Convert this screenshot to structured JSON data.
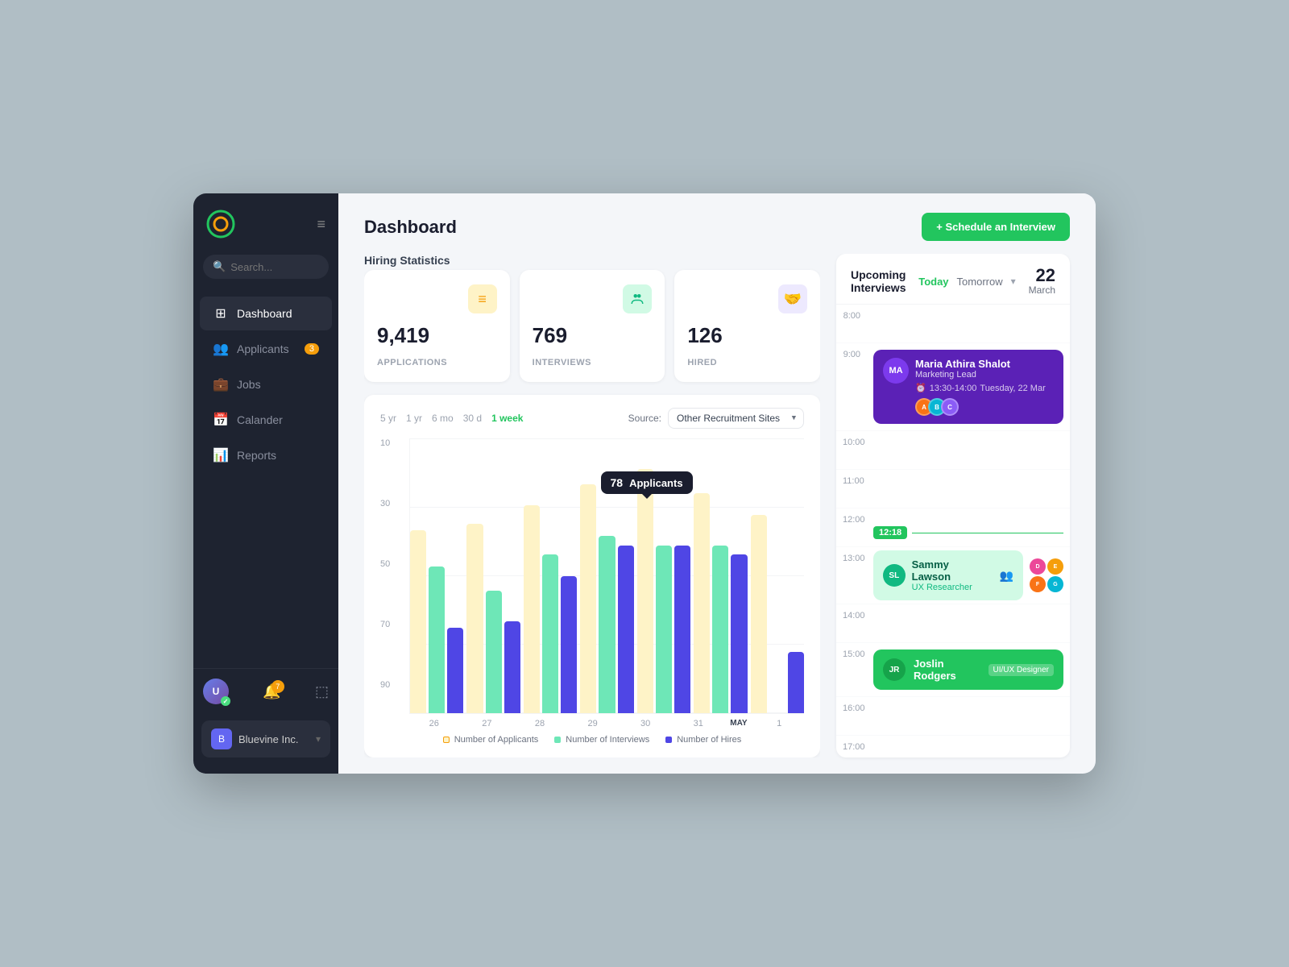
{
  "app": {
    "logo_text": "O",
    "company": "Bluevine Inc."
  },
  "sidebar": {
    "search_placeholder": "Search...",
    "nav_items": [
      {
        "id": "dashboard",
        "label": "Dashboard",
        "icon": "⊞",
        "active": true,
        "badge": null
      },
      {
        "id": "applicants",
        "label": "Applicants",
        "icon": "👥",
        "active": false,
        "badge": "3"
      },
      {
        "id": "jobs",
        "label": "Jobs",
        "icon": "💼",
        "active": false,
        "badge": null
      },
      {
        "id": "calendar",
        "label": "Calander",
        "icon": "📅",
        "active": false,
        "badge": null
      },
      {
        "id": "reports",
        "label": "Reports",
        "icon": "📊",
        "active": false,
        "badge": null
      }
    ],
    "user_notif_count": "7"
  },
  "header": {
    "title": "Dashboard",
    "schedule_btn": "+ Schedule an Interview"
  },
  "stats": {
    "section_title": "Hiring Statistics",
    "cards": [
      {
        "number": "9,419",
        "label": "APPLICATIONS",
        "icon": "≡",
        "icon_class": "stat-icon-yellow"
      },
      {
        "number": "769",
        "label": "INTERVIEWS",
        "icon": "👥",
        "icon_class": "stat-icon-green"
      },
      {
        "number": "126",
        "label": "HIRED",
        "icon": "🤝",
        "icon_class": "stat-icon-purple"
      }
    ]
  },
  "chart": {
    "time_filters": [
      "5 yr",
      "1 yr",
      "6 mo",
      "30 d",
      "1 week"
    ],
    "active_filter": "1 week",
    "source_label": "Source:",
    "source_value": "Other Recruitment Sites",
    "y_labels": [
      "90",
      "70",
      "50",
      "30",
      "10"
    ],
    "x_labels": [
      "26",
      "27",
      "28",
      "29",
      "30",
      "31",
      "1"
    ],
    "may_label": "MAY",
    "tooltip": {
      "number": "78",
      "label": "Applicants"
    },
    "bars": [
      {
        "applicants": 60,
        "interviews": 48,
        "hires": 28
      },
      {
        "applicants": 62,
        "interviews": 40,
        "hires": 30
      },
      {
        "applicants": 68,
        "interviews": 52,
        "hires": 45
      },
      {
        "applicants": 75,
        "interviews": 58,
        "hires": 55
      },
      {
        "applicants": 80,
        "interviews": 55,
        "hires": 55
      },
      {
        "applicants": 72,
        "interviews": 55,
        "hires": 52
      },
      {
        "applicants": 65,
        "interviews": 0,
        "hires": 20
      }
    ],
    "legend": [
      {
        "label": "Number of Applicants",
        "color": "#fef3c7"
      },
      {
        "label": "Number of Interviews",
        "color": "#6ee7b7"
      },
      {
        "label": "Number of Hires",
        "color": "#4f46e5"
      }
    ]
  },
  "upcoming": {
    "title": "Upcoming Interviews",
    "today_label": "Today",
    "tomorrow_label": "Tomorrow",
    "date_number": "22",
    "date_month": "March",
    "time_slots": [
      {
        "time": "8:00"
      },
      {
        "time": "9:00"
      },
      {
        "time": "10:00"
      },
      {
        "time": "11:00"
      },
      {
        "time": "12:00"
      },
      {
        "time": "13:00"
      },
      {
        "time": "14:00"
      },
      {
        "time": "15:00"
      },
      {
        "time": "16:00"
      },
      {
        "time": "17:00"
      }
    ],
    "interviews": [
      {
        "name": "Maria Athira Shalot",
        "role": "Marketing Lead",
        "time": "13:30-14:00",
        "date": "Tuesday, 22 Mar",
        "color": "purple",
        "slot": "9:00"
      },
      {
        "name": "Sammy Lawson",
        "role": "UX Researcher",
        "color": "light-green",
        "slot": "13:00"
      },
      {
        "name": "Joslin Rodgers",
        "role": "UI/UX Designer",
        "color": "green",
        "slot": "15:00"
      }
    ],
    "current_time": "12:18"
  }
}
